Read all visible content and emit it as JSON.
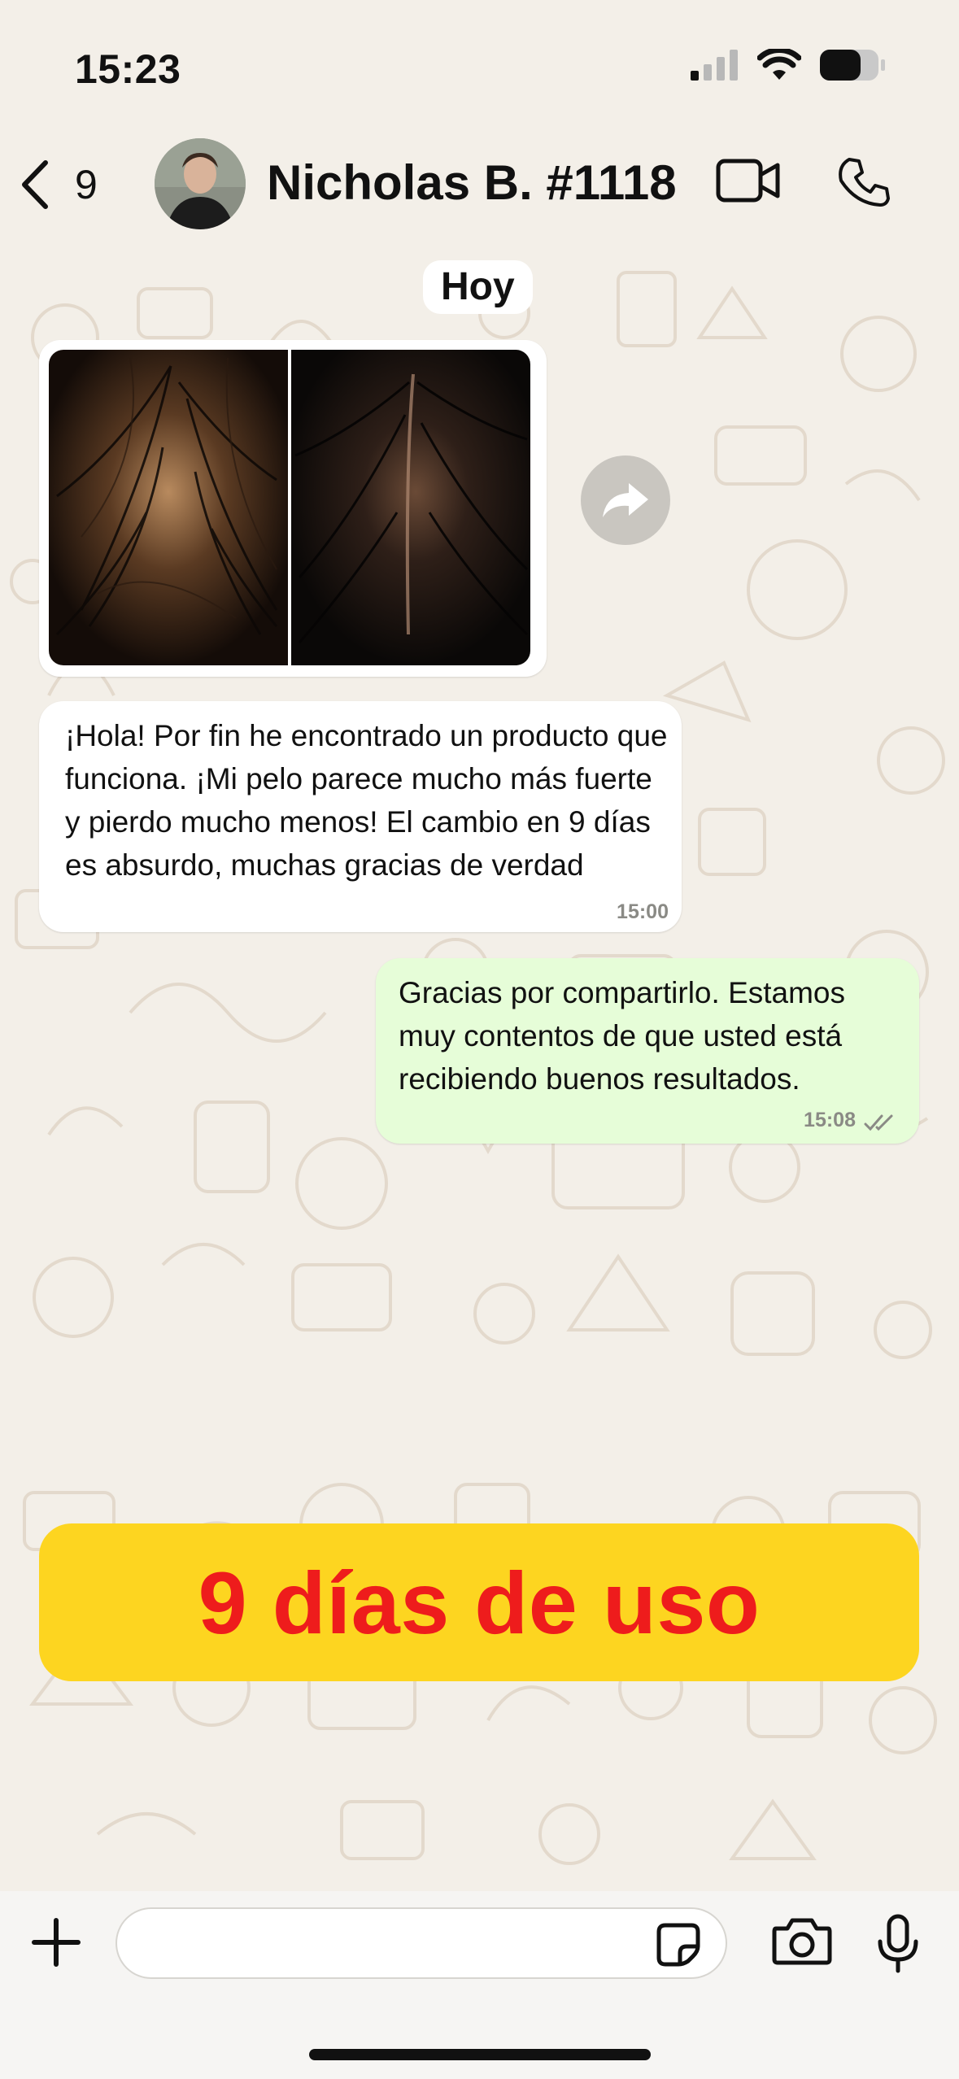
{
  "status_bar": {
    "time": "15:23",
    "signal": "signal-icon",
    "wifi": "wifi-icon",
    "battery": "battery-icon"
  },
  "header": {
    "back_icon": "chevron-left-icon",
    "unread_count": "9",
    "contact_name": "Nicholas B. #1118",
    "video_icon": "video-camera-icon",
    "call_icon": "phone-icon"
  },
  "chat": {
    "date_label": "Hoy",
    "image_message": {
      "forward_icon": "forward-icon"
    },
    "incoming": {
      "text": "¡Hola! Por fin he encontrado un producto que funciona. ¡Mi pelo parece mucho más fuerte y pierdo mucho menos! El cambio en 9 días es absurdo, muchas gracias de verdad",
      "time": "15:00"
    },
    "outgoing": {
      "text": "Gracias por compartirlo. Estamos muy contentos de que usted está recibiendo buenos resultados.",
      "time": "15:08",
      "status_icon": "double-check-icon"
    }
  },
  "banner": {
    "text": "9 días de uso",
    "background": "#fdd520",
    "color": "#ee1c1c"
  },
  "input_bar": {
    "plus_icon": "plus-icon",
    "input_value": "",
    "sticker_icon": "sticker-icon",
    "camera_icon": "camera-icon",
    "mic_icon": "microphone-icon"
  },
  "colors": {
    "background": "#f3efe8",
    "outgoing_bubble": "#e6fdd8",
    "incoming_bubble": "#ffffff"
  }
}
